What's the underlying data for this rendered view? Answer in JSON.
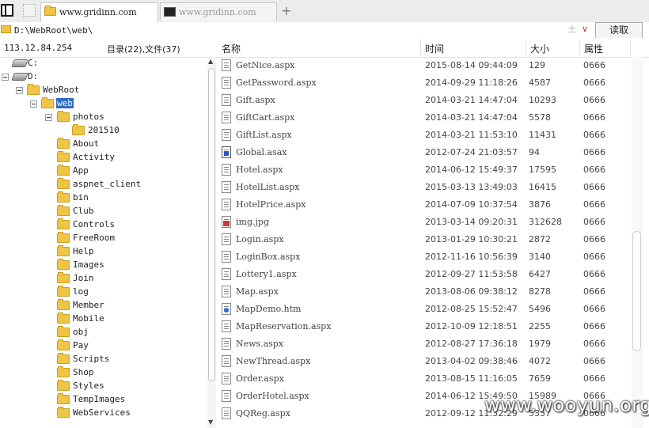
{
  "tabs": [
    {
      "label": "www.gridinn.com",
      "active": true
    },
    {
      "label": "www.gridinn.com",
      "active": false
    }
  ],
  "address": {
    "path": "D:\\WebRoot\\web\\",
    "read_label": "读取"
  },
  "left_header": {
    "ip": "113.12.84.254",
    "counts": "目录(22),文件(37)"
  },
  "tree": {
    "drive_c": "C:",
    "drive_d": "D:",
    "webroot": "WebRoot",
    "web": "web",
    "photos": "photos",
    "photos_child": "201510",
    "folders": [
      "About",
      "Activity",
      "App",
      "aspnet_client",
      "bin",
      "Club",
      "Controls",
      "FreeRoom",
      "Help",
      "Images",
      "Join",
      "log",
      "Member",
      "Mobile",
      "obj",
      "Pay",
      "Scripts",
      "Shop",
      "Styles",
      "TempImages",
      "WebServices"
    ]
  },
  "columns": {
    "name": "名称",
    "time": "时间",
    "size": "大小",
    "attr": "属性"
  },
  "files": [
    {
      "name": "GetNice.aspx",
      "time": "2015-08-14 09:44:09",
      "size": "129",
      "attr": "0666",
      "icon": "aspx"
    },
    {
      "name": "GetPassword.aspx",
      "time": "2014-09-29 11:18:26",
      "size": "4587",
      "attr": "0666",
      "icon": "aspx"
    },
    {
      "name": "Gift.aspx",
      "time": "2014-03-21 14:47:04",
      "size": "10293",
      "attr": "0666",
      "icon": "aspx"
    },
    {
      "name": "GiftCart.aspx",
      "time": "2014-03-21 14:47:04",
      "size": "5578",
      "attr": "0666",
      "icon": "aspx"
    },
    {
      "name": "GiftList.aspx",
      "time": "2014-03-21 11:53:10",
      "size": "11431",
      "attr": "0666",
      "icon": "aspx"
    },
    {
      "name": "Global.asax",
      "time": "2012-07-24 21:03:57",
      "size": "94",
      "attr": "0666",
      "icon": "asax"
    },
    {
      "name": "Hotel.aspx",
      "time": "2014-06-12 15:49:37",
      "size": "17595",
      "attr": "0666",
      "icon": "aspx"
    },
    {
      "name": "HotelList.aspx",
      "time": "2015-03-13 13:49:03",
      "size": "16415",
      "attr": "0666",
      "icon": "aspx"
    },
    {
      "name": "HotelPrice.aspx",
      "time": "2014-07-09 10:37:54",
      "size": "3876",
      "attr": "0666",
      "icon": "aspx"
    },
    {
      "name": "img.jpg",
      "time": "2013-03-14 09:20:31",
      "size": "312628",
      "attr": "0666",
      "icon": "jpg"
    },
    {
      "name": "Login.aspx",
      "time": "2013-01-29 10:30:21",
      "size": "2872",
      "attr": "0666",
      "icon": "aspx"
    },
    {
      "name": "LoginBox.aspx",
      "time": "2012-11-16 10:56:39",
      "size": "3140",
      "attr": "0666",
      "icon": "aspx"
    },
    {
      "name": "Lottery1.aspx",
      "time": "2012-09-27 11:53:58",
      "size": "6427",
      "attr": "0666",
      "icon": "aspx"
    },
    {
      "name": "Map.aspx",
      "time": "2013-08-06 09:38:12",
      "size": "8278",
      "attr": "0666",
      "icon": "aspx"
    },
    {
      "name": "MapDemo.htm",
      "time": "2012-08-25 15:52:47",
      "size": "5496",
      "attr": "0666",
      "icon": "htm"
    },
    {
      "name": "MapReservation.aspx",
      "time": "2012-10-09 12:18:51",
      "size": "2255",
      "attr": "0666",
      "icon": "aspx"
    },
    {
      "name": "News.aspx",
      "time": "2012-08-27 17:36:18",
      "size": "1979",
      "attr": "0666",
      "icon": "aspx"
    },
    {
      "name": "NewThread.aspx",
      "time": "2013-04-02 09:38:46",
      "size": "4072",
      "attr": "0666",
      "icon": "aspx"
    },
    {
      "name": "Order.aspx",
      "time": "2013-08-15 11:16:05",
      "size": "7659",
      "attr": "0666",
      "icon": "aspx"
    },
    {
      "name": "OrderHotel.aspx",
      "time": "2014-06-12 15:49:50",
      "size": "15989",
      "attr": "0666",
      "icon": "aspx"
    },
    {
      "name": "QQReg.aspx",
      "time": "2012-09-12 11:32:29",
      "size": "5357",
      "attr": "0666",
      "icon": "aspx"
    }
  ],
  "watermark": "www.wooyun.org"
}
